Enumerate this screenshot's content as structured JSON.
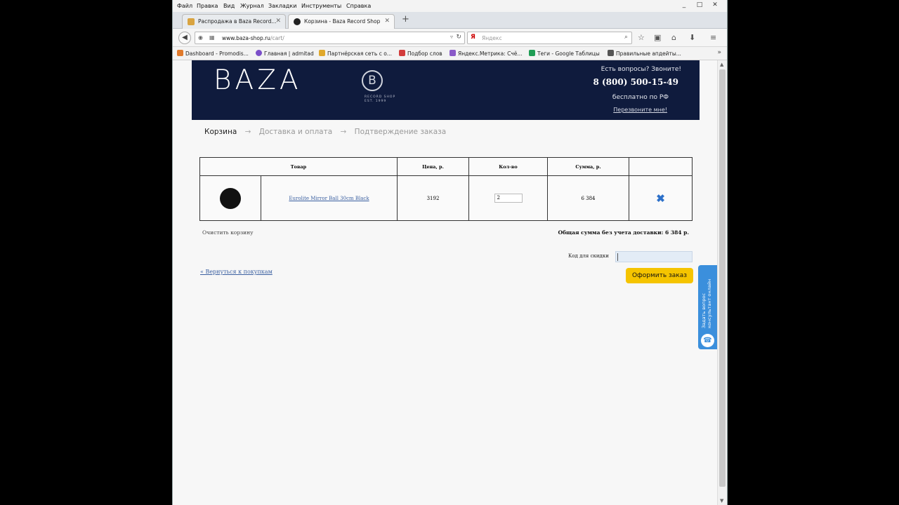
{
  "browser": {
    "menu": [
      "Файл",
      "Правка",
      "Вид",
      "Журнал",
      "Закладки",
      "Инструменты",
      "Справка"
    ],
    "window_controls": [
      "_",
      "□",
      "✕"
    ],
    "tabs": [
      {
        "label": "Распродажа в Baza Record...",
        "active": false,
        "color": "#d9a441"
      },
      {
        "label": "Корзина - Baza Record Shop",
        "active": true,
        "color": "#222222"
      }
    ],
    "newtab": "+",
    "url_host": "www.baza-shop.ru",
    "url_path": "/cart/",
    "search_placeholder": "Яндекс",
    "bookmarks": [
      {
        "label": "Dashboard - Promodis...",
        "color": "#e07a2c"
      },
      {
        "label": "Главная | admitad",
        "color": "#7b4fc9"
      },
      {
        "label": "Партнёрская сеть с о...",
        "color": "#e0a82c"
      },
      {
        "label": "Подбор слов",
        "color": "#d23c3c"
      },
      {
        "label": "Яндекс.Метрика: Счё...",
        "color": "#8a5ac8"
      },
      {
        "label": "Теги - Google Таблицы",
        "color": "#1f9d55"
      },
      {
        "label": "Правильные апдейты...",
        "color": "#555555"
      }
    ],
    "bookmarks_more": "»"
  },
  "header": {
    "logo": "BAZA",
    "logo_mark": "B",
    "logo_sub": "RECORD SHOP\nEST. 1999",
    "question": "Есть вопросы? Звоните!",
    "phone": "8 (800) 500-15-49",
    "free": "бесплатно по РФ",
    "callback": "Перезвоните мне!"
  },
  "breadcrumb": {
    "current": "Корзина",
    "step2": "Доставка и оплата",
    "step3": "Подтверждение заказа",
    "sep": "→"
  },
  "cart": {
    "headers": [
      "Товар",
      "Цена, р.",
      "Кол-во",
      "Сумма, р."
    ],
    "rows": [
      {
        "name": "Eurolite Mirror Ball 30cm Black",
        "price": "3192",
        "qty": "2",
        "sum": "6 384"
      }
    ],
    "delete_icon": "✖"
  },
  "clear_cart": "Очистить корзину",
  "total": "Общая сумма без учета доставки: 6 384 р.",
  "promo_label": "Код для скидки",
  "promo_value": "",
  "back_to_shop": "« Вернуться к покупкам",
  "order_button": "Оформить заказ",
  "ask_widget": {
    "line1": "Задать вопрос",
    "line2": "консультант онлайн",
    "icon": "☎"
  }
}
